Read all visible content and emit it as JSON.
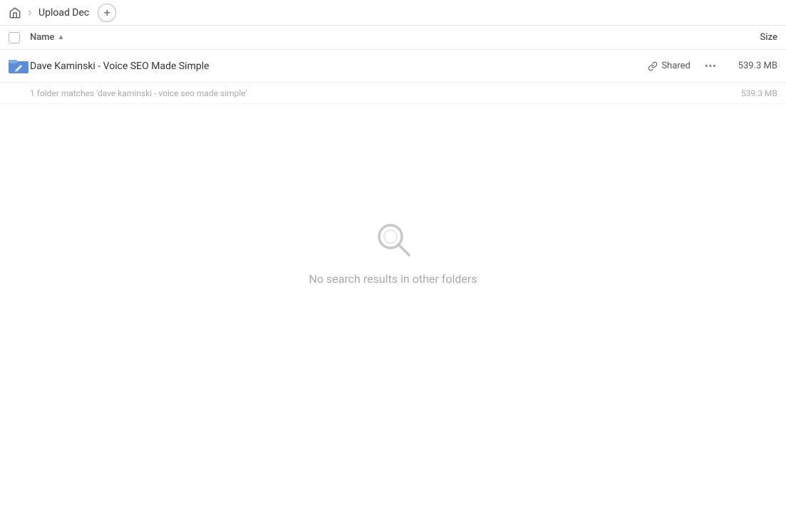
{
  "breadcrumb": {
    "home_label": "Home",
    "title": "Upload Dec",
    "add_button_label": "+"
  },
  "columns": {
    "name_label": "Name",
    "sort_indicator": "▲",
    "size_label": "Size"
  },
  "file_row": {
    "name": "Dave Kaminski - Voice SEO Made Simple",
    "shared_label": "Shared",
    "size": "539.3 MB",
    "more_label": "•••"
  },
  "match_row": {
    "text": "1 folder matches 'dave kaminski - voice seo made simple'",
    "size": "539.3 MB"
  },
  "empty_state": {
    "label": "No search results in other folders"
  }
}
